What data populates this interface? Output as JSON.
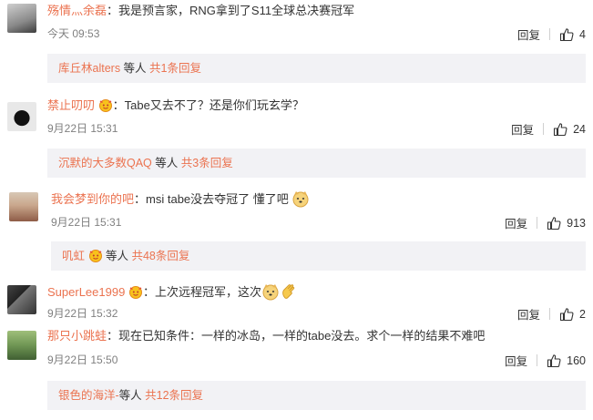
{
  "comments": [
    {
      "user": "殇情灬余磊",
      "text": "我是预言家，RNG拿到了S11全球总决赛冠军",
      "time": "今天 09:53",
      "reply_label": "回复",
      "likes": "4",
      "sub": {
        "names": "库丘林alters",
        "rest": " 等人 ",
        "count": "共1条回复"
      }
    },
    {
      "user": "禁止叨叨",
      "text": "Tabe又去不了？还是你们玩玄学？",
      "time": "9月22日 15:31",
      "reply_label": "回复",
      "likes": "24",
      "sub": {
        "names": "沉默的大多数QAQ",
        "rest": " 等人 ",
        "count": "共3条回复"
      }
    },
    {
      "user": "我会梦到你的吧",
      "text": "msi tabe没去夺冠了 懂了吧",
      "time": "9月22日 15:31",
      "reply_label": "回复",
      "likes": "913",
      "sub": {
        "names": "叽虹",
        "rest": " 等人 ",
        "count": "共48条回复"
      }
    },
    {
      "user": "SuperLee1999",
      "text": "上次远程冠军，这次",
      "time": "9月22日 15:32",
      "reply_label": "回复",
      "likes": "2"
    },
    {
      "user": "那只小跳蛙",
      "text": "现在已知条件：一样的冰岛，一样的tabe没去。求个一样的结果不难吧",
      "time": "9月22日 15:50",
      "reply_label": "回复",
      "likes": "160",
      "sub": {
        "names": "银色的海洋-",
        "rest": "等人 ",
        "count": "共12条回复"
      }
    }
  ],
  "colors": {
    "username": "#eb7350",
    "subbox_bg": "#f2f2f5",
    "time": "#808080"
  },
  "icons": {
    "like": "thumbs-up-icon",
    "badge": "vip-badge-icon",
    "emoji": "doge-emoji-icon"
  }
}
